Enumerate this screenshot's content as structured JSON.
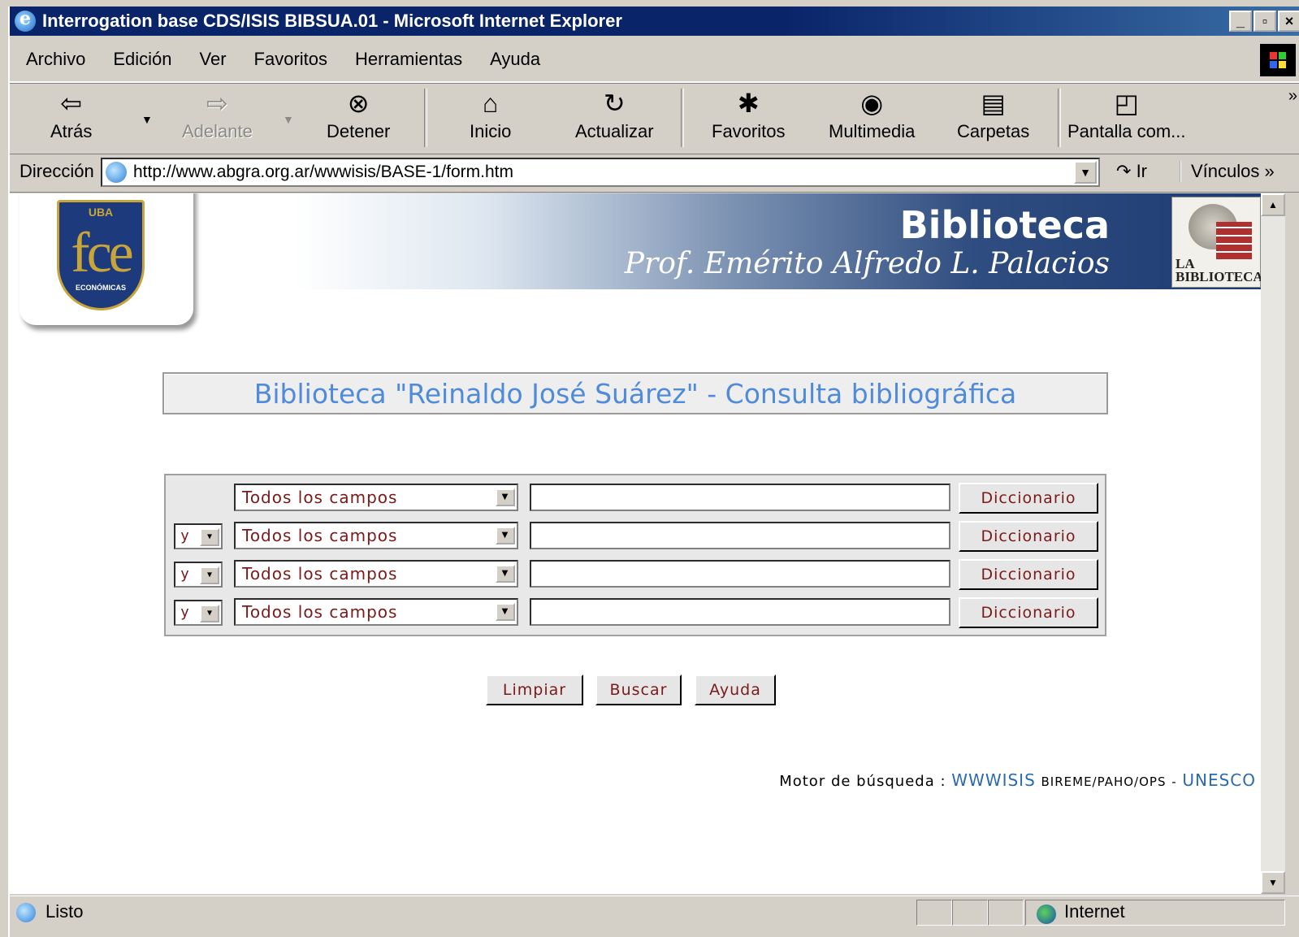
{
  "window": {
    "title": "Interrogation base CDS/ISIS BIBSUA.01 - Microsoft Internet Explorer",
    "controls": [
      "_",
      "▫",
      "×"
    ]
  },
  "menu": [
    "Archivo",
    "Edición",
    "Ver",
    "Favoritos",
    "Herramientas",
    "Ayuda"
  ],
  "toolbar": {
    "back": "Atrás",
    "forward": "Adelante",
    "stop": "Detener",
    "home": "Inicio",
    "refresh": "Actualizar",
    "favorites": "Favoritos",
    "media": "Multimedia",
    "folders": "Carpetas",
    "fullscreen": "Pantalla com...",
    "more": "»"
  },
  "address": {
    "label": "Dirección",
    "url": "http://www.abgra.org.ar/wwwisis/BASE-1/form.htm",
    "go": "Ir",
    "links": "Vínculos",
    "links_more": "»"
  },
  "page": {
    "logo": {
      "top": "UBA",
      "letters": "fce",
      "bottom": "ECONÓMICAS"
    },
    "banner_title": "Biblioteca",
    "banner_subtitle": "Prof. Emérito Alfredo L. Palacios",
    "labib_text": "LA BIBLIOTECA",
    "heading": "Biblioteca \"Reinaldo José Suárez\" - Consulta bibliográfica",
    "rows": [
      {
        "operator": "",
        "field": "Todos los campos",
        "value": "",
        "button": "Diccionario"
      },
      {
        "operator": "y",
        "field": "Todos los campos",
        "value": "",
        "button": "Diccionario"
      },
      {
        "operator": "y",
        "field": "Todos los campos",
        "value": "",
        "button": "Diccionario"
      },
      {
        "operator": "y",
        "field": "Todos los campos",
        "value": "",
        "button": "Diccionario"
      }
    ],
    "actions": {
      "clear": "Limpiar",
      "search": "Buscar",
      "help": "Ayuda"
    },
    "footer": {
      "prefix": "Motor de búsqueda :",
      "engine_link": "WWWISIS",
      "org": "BIREME/PAHO/OPS",
      "dash": "-",
      "unesco_link": "UNESCO"
    }
  },
  "status": {
    "text": "Listo",
    "zone": "Internet"
  },
  "colors": {
    "titlebar": "#0a246a",
    "chrome": "#d4d0c8",
    "heading_text": "#4f8bd8",
    "form_text": "#7a1a1a",
    "link": "#2a6ab0"
  }
}
